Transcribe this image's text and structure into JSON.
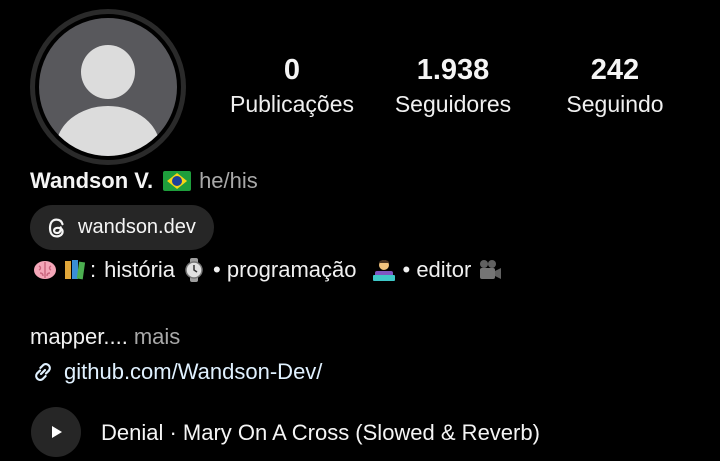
{
  "profile": {
    "name": "Wandson V.",
    "pronouns": "he/his",
    "flag_icon": "brazil-flag-icon"
  },
  "stats": {
    "posts_value": "0",
    "posts_label": "Publicações",
    "followers_value": "1.938",
    "followers_label": "Seguidores",
    "following_value": "242",
    "following_label": "Seguindo"
  },
  "threads": {
    "label": "wandson.dev",
    "icon": "threads-icon"
  },
  "bio": {
    "separator_colon": ":",
    "item_history": "história",
    "item_programming": "• programação",
    "item_editor": "• editor",
    "icons": [
      "brain-icon",
      "books-icon",
      "watch-icon",
      "technologist-icon",
      "movie-camera-icon"
    ],
    "truncated_text": "mapper....",
    "more_label": "mais"
  },
  "link": {
    "text": "github.com/Wandson-Dev/",
    "icon": "link-icon"
  },
  "music": {
    "track": "Denial · Mary On A Cross (Slowed & Reverb)",
    "icon": "play-icon"
  },
  "colors": {
    "background": "#000000",
    "pill_background": "#262626",
    "secondary_text": "#a8a8a8",
    "link_text": "#e0f1ff",
    "avatar_gray": "#58585c"
  }
}
